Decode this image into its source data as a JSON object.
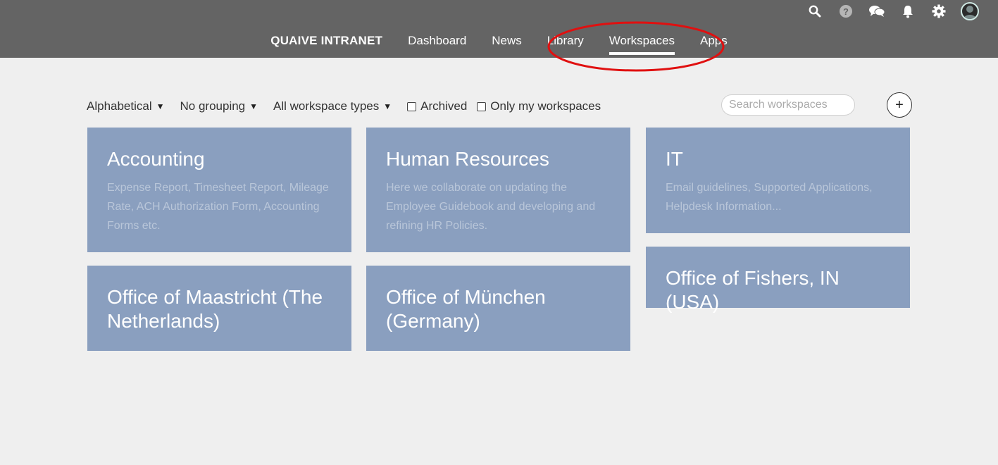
{
  "header": {
    "brand": "QUAIVE INTRANET",
    "nav": [
      {
        "label": "Dashboard"
      },
      {
        "label": "News"
      },
      {
        "label": "Library"
      },
      {
        "label": "Workspaces"
      },
      {
        "label": "Apps"
      }
    ],
    "active_nav": "Workspaces"
  },
  "toolbar": {
    "sort_label": "Alphabetical",
    "grouping_label": "No grouping",
    "types_label": "All workspace types",
    "archived_label": "Archived",
    "only_mine_label": "Only my workspaces",
    "search_placeholder": "Search workspaces",
    "add_label": "+"
  },
  "workspaces": [
    {
      "title": "Accounting",
      "description": "Expense Report, Timesheet Report, Mileage Rate, ACH Authorization Form, Accounting Forms etc."
    },
    {
      "title": "Human Resources",
      "description": "Here we collaborate on updating the Employee Guidebook and developing and refining HR Policies."
    },
    {
      "title": "IT",
      "description": "Email guidelines, Supported Applications, Helpdesk Information..."
    },
    {
      "title": "Office of Maastricht (The Netherlands)",
      "description": ""
    },
    {
      "title": "Office of München (Germany)",
      "description": ""
    },
    {
      "title": "Office of Fishers, IN (USA)",
      "description": ""
    }
  ],
  "colors": {
    "topbar": "#646464",
    "tile": "#8a9fbf",
    "highlight": "#e01010"
  }
}
